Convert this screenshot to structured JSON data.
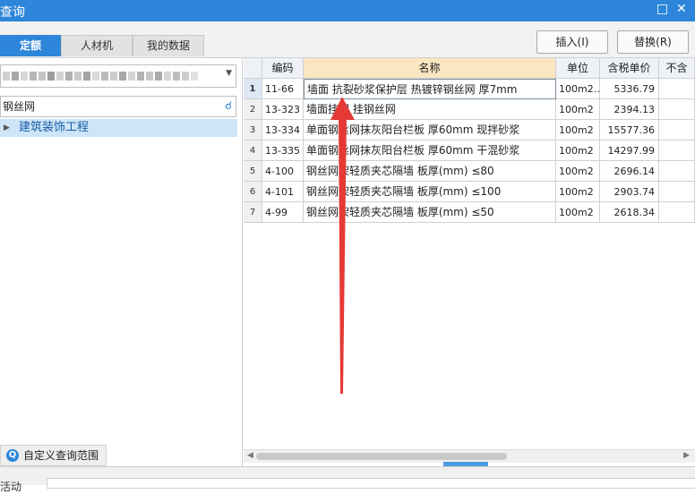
{
  "window": {
    "title": "查询",
    "restore_icon": "restore-icon",
    "close_icon": "close-icon"
  },
  "tabs": [
    {
      "label": "定额",
      "active": true
    },
    {
      "label": "人材机",
      "active": false
    },
    {
      "label": "我的数据",
      "active": false
    }
  ],
  "toolbar": {
    "insert_label": "插入(I)",
    "replace_label": "替换(R)"
  },
  "left": {
    "search_value": "钢丝网",
    "tree": [
      {
        "label": "建筑装饰工程",
        "selected": true
      }
    ],
    "custom_range_label": "自定义查询范围"
  },
  "grid": {
    "columns": [
      "编码",
      "名称",
      "单位",
      "含税单价",
      "不含"
    ],
    "rows": [
      {
        "no": "1",
        "code": "11-66",
        "name": "墙面 抗裂砂浆保护层 热镀锌钢丝网 厚7mm",
        "unit": "100m2…",
        "price": "5336.79"
      },
      {
        "no": "2",
        "code": "13-323",
        "name": "墙面挂网 挂钢丝网",
        "unit": "100m2",
        "price": "2394.13"
      },
      {
        "no": "3",
        "code": "13-334",
        "name": "单面钢丝网抹灰阳台栏板 厚60mm 现拌砂浆",
        "unit": "100m2",
        "price": "15577.36"
      },
      {
        "no": "4",
        "code": "13-335",
        "name": "单面钢丝网抹灰阳台栏板 厚60mm 干混砂浆",
        "unit": "100m2",
        "price": "14297.99"
      },
      {
        "no": "5",
        "code": "4-100",
        "name": "钢丝网架轻质夹芯隔墙 板厚(mm) ≤80",
        "unit": "100m2",
        "price": "2696.14"
      },
      {
        "no": "6",
        "code": "4-101",
        "name": "钢丝网架轻质夹芯隔墙 板厚(mm) ≤100",
        "unit": "100m2",
        "price": "2903.74"
      },
      {
        "no": "7",
        "code": "4-99",
        "name": "钢丝网架轻质夹芯隔墙 板厚(mm) ≤50",
        "unit": "100m2",
        "price": "2618.34"
      }
    ]
  },
  "status": {
    "text": "活动"
  },
  "colors": {
    "accent": "#2d86d9",
    "arrow": "#e53935"
  }
}
